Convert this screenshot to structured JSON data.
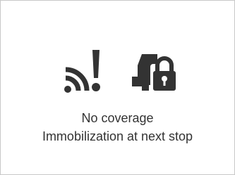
{
  "status_panel": {
    "line1": "No coverage",
    "line2": "Immobilization at next stop",
    "icons": {
      "coverage": "no-coverage-wifi-warning-icon",
      "immobilization": "vehicle-lock-icon"
    },
    "colors": {
      "icon": "#333333",
      "text": "#333333",
      "border": "#c8c8c8",
      "background": "#ffffff"
    }
  }
}
